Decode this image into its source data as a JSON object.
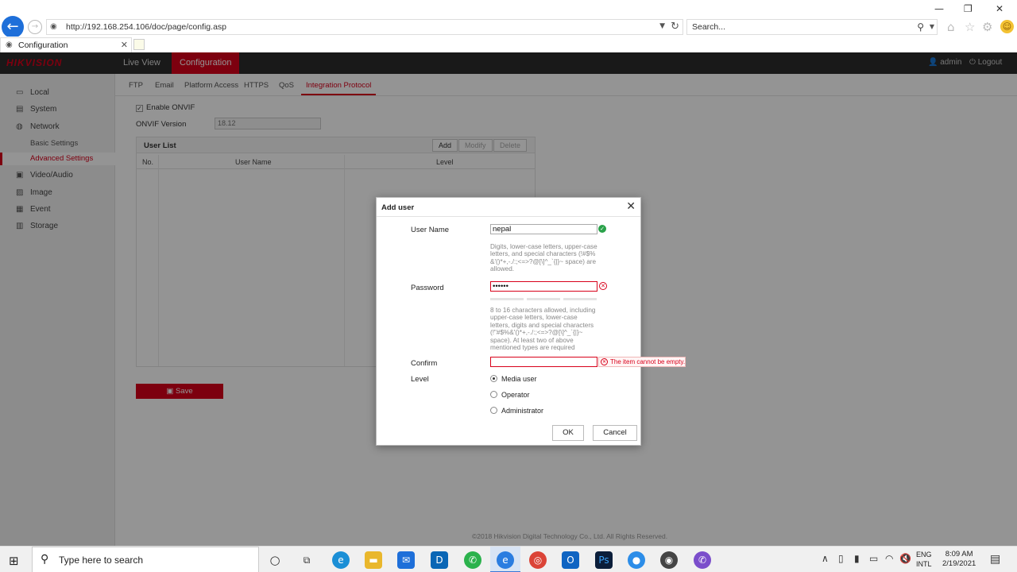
{
  "browser": {
    "url": "http://192.168.254.106/doc/page/config.asp",
    "search_placeholder": "Search...",
    "tab_title": "Configuration"
  },
  "app": {
    "logo": "HIKVISION",
    "nav": {
      "live_view": "Live View",
      "configuration": "Configuration"
    },
    "user": "admin",
    "logout": "Logout",
    "sidebar": {
      "local": "Local",
      "system": "System",
      "network": "Network",
      "basic_settings": "Basic Settings",
      "advanced_settings": "Advanced Settings",
      "video_audio": "Video/Audio",
      "image": "Image",
      "event": "Event",
      "storage": "Storage"
    },
    "subtabs": {
      "ftp": "FTP",
      "email": "Email",
      "platform_access": "Platform Access",
      "https": "HTTPS",
      "qos": "QoS",
      "integration_protocol": "Integration Protocol"
    },
    "enable_onvif": "Enable ONVIF",
    "onvif_version_label": "ONVIF Version",
    "onvif_version": "18.12",
    "user_list": {
      "title": "User List",
      "add": "Add",
      "modify": "Modify",
      "delete": "Delete",
      "col_no": "No.",
      "col_user_name": "User Name",
      "col_level": "Level"
    },
    "save": "Save",
    "copyright": "©2018 Hikvision Digital Technology Co., Ltd. All Rights Reserved."
  },
  "dialog": {
    "title": "Add user",
    "username_label": "User Name",
    "username_value": "nepal",
    "username_hint": "Digits, lower-case letters, upper-case letters, and special characters (!#$% &'()*+,-./:;<=>?@[\\]^_`{|}~ space) are allowed.",
    "password_label": "Password",
    "password_value": "••••••",
    "password_hint": "8 to 16 characters allowed, including upper-case letters, lower-case letters, digits and special characters (!\"#$%&'()*+,-./:;<=>?@[\\]^_`{|}~ space). At least two of above mentioned types are required",
    "confirm_label": "Confirm",
    "confirm_value": "",
    "confirm_error": "The item cannot be empty.",
    "level_label": "Level",
    "levels": [
      "Media user",
      "Operator",
      "Administrator"
    ],
    "ok": "OK",
    "cancel": "Cancel"
  },
  "taskbar": {
    "search_placeholder": "Type here to search",
    "lang_top": "ENG",
    "lang_bottom": "INTL",
    "time": "8:09 AM",
    "date": "2/19/2021"
  },
  "colors": {
    "accent": "#d8001a",
    "header": "#2b2b2b",
    "ok": "#2aa24a"
  }
}
